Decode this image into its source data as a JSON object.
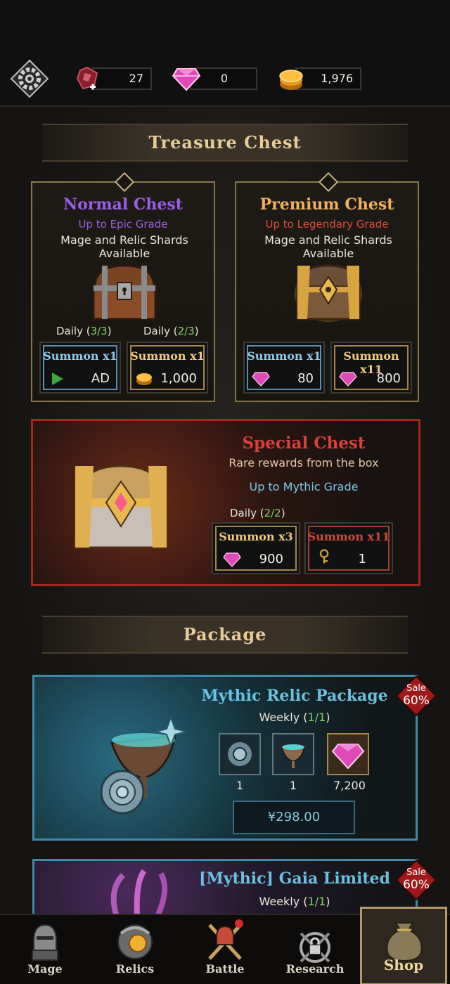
{
  "topbar": {
    "resources": [
      {
        "icon": "heart-crystal-icon",
        "value": "27"
      },
      {
        "icon": "gem-icon",
        "value": "0"
      },
      {
        "icon": "gold-coin-icon",
        "value": "1,976"
      }
    ]
  },
  "treasure": {
    "section_title": "Treasure Chest",
    "normal": {
      "title": "Normal Chest",
      "grade": "Up to Epic Grade",
      "desc": "Mage and Relic Shards Available",
      "daily_left_prefix": "Daily (",
      "daily_left_count": "3/3",
      "daily_right_prefix": "Daily (",
      "daily_right_count": "2/3",
      "close": ")",
      "btn1": {
        "label": "Summon x1",
        "cost": "AD"
      },
      "btn2": {
        "label": "Summon x1",
        "cost": "1,000"
      }
    },
    "premium": {
      "title": "Premium Chest",
      "grade": "Up to Legendary Grade",
      "desc": "Mage and Relic Shards Available",
      "btn1": {
        "label": "Summon x1",
        "cost": "80"
      },
      "btn2": {
        "label": "Summon x11",
        "cost": "800"
      }
    },
    "special": {
      "title": "Special Chest",
      "sub": "Rare rewards from the box",
      "grade": "Up to Mythic Grade",
      "daily_prefix": "Daily (",
      "daily_count": "2/2",
      "close": ")",
      "btn1": {
        "label": "Summon x3",
        "cost": "900"
      },
      "btn2": {
        "label": "Summon x11",
        "cost": "1"
      }
    }
  },
  "package": {
    "section_title": "Package",
    "mythic": {
      "title": "Mythic Relic Package",
      "weekly_prefix": "Weekly (",
      "weekly_count": "1/1",
      "close": ")",
      "sale_word": "Sale",
      "sale_pct": "60%",
      "items": [
        {
          "icon": "rose-icon",
          "qty": "1"
        },
        {
          "icon": "chalice-icon",
          "qty": "1"
        },
        {
          "icon": "gem-icon",
          "qty": "7,200"
        }
      ],
      "price": "¥298.00"
    },
    "gaia": {
      "title": "[Mythic] Gaia Limited",
      "weekly_prefix": "Weekly (",
      "weekly_count": "1/1",
      "close": ")",
      "sale_word": "Sale",
      "sale_pct": "60%"
    }
  },
  "nav": {
    "items": [
      {
        "label": "Mage"
      },
      {
        "label": "Relics"
      },
      {
        "label": "Battle"
      },
      {
        "label": "Research"
      },
      {
        "label": "Shop"
      }
    ]
  },
  "colors": {
    "normal_title": "#9b5de5",
    "premium_title": "#f0b060",
    "special_title": "#d8403a",
    "package_title": "#6ac2e0",
    "daily_green": "#7fd16a"
  }
}
